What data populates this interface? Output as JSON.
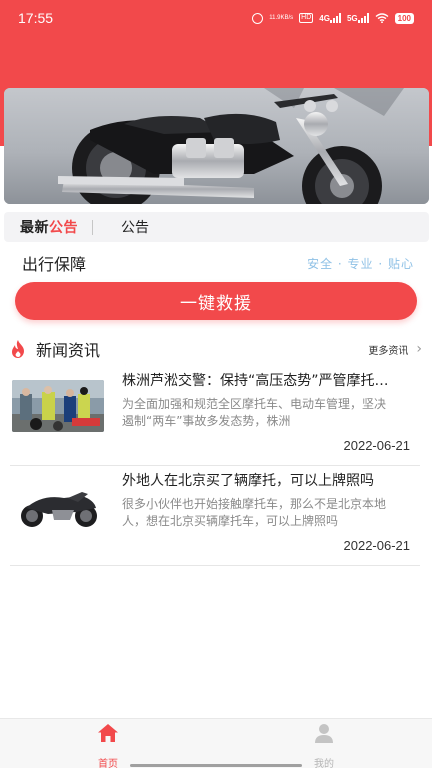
{
  "status_bar": {
    "time": "17:55",
    "speed_value": "11.9",
    "speed_unit": "KB/s",
    "hd_label": "HD",
    "sim1_label": "4G",
    "sim2_label": "5G",
    "battery": "100"
  },
  "banner": {
    "image": "motorcycle-photo"
  },
  "notice": {
    "title_part1": "最新",
    "title_part2": "公告",
    "text": "公告"
  },
  "guarantee": {
    "title": "出行保障",
    "slogan": "安全 · 专业 · 贴心"
  },
  "sos_button": {
    "label": "一键救援"
  },
  "news": {
    "title": "新闻资讯",
    "more_label": "更多资讯",
    "items": [
      {
        "title": "株洲芦淞交警：保持“高压态势”严管摩托车、电动车",
        "summary": "为全面加强和规范全区摩托车、电动车管理，坚决遏制“两车”事故多发态势，株洲",
        "date": "2022-06-21",
        "thumb": "traffic-police-photo"
      },
      {
        "title": "外地人在北京买了辆摩托，可以上牌照吗",
        "summary": "很多小伙伴也开始接触摩托车，那么不是北京本地人，想在北京买辆摩托车，可以上牌照吗",
        "date": "2022-06-21",
        "thumb": "motorcycle-photo"
      }
    ]
  },
  "bottom_nav": {
    "items": [
      {
        "label": "首页",
        "icon": "home-icon",
        "active": true
      },
      {
        "label": "我的",
        "icon": "user-icon",
        "active": false
      }
    ]
  },
  "colors": {
    "brand_red": "#f2494b",
    "slogan_blue": "#8fc1e6",
    "inactive_gray": "#b5b5b5"
  }
}
